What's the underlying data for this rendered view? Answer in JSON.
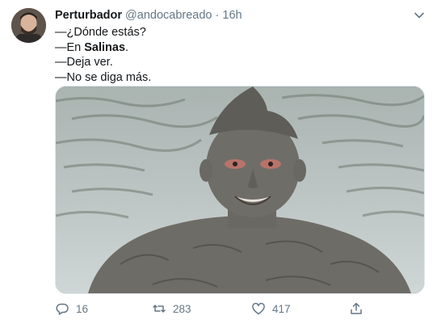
{
  "tweet": {
    "display_name": "Perturbador",
    "handle": "@andocabreado",
    "separator": "·",
    "time": "16h",
    "lines": [
      {
        "pre": "—¿Dónde estás?",
        "bold": "",
        "post": ""
      },
      {
        "pre": "—En ",
        "bold": "Salinas",
        "post": "."
      },
      {
        "pre": "—Deja ver.",
        "bold": "",
        "post": ""
      },
      {
        "pre": "—No se diga más.",
        "bold": "",
        "post": ""
      }
    ],
    "media": {
      "description_icon": "photo-person-covered-in-mud"
    },
    "actions": {
      "reply_count": "16",
      "retweet_count": "283",
      "like_count": "417"
    }
  },
  "colors": {
    "text": "#14171a",
    "secondary": "#657786",
    "border": "#e1e8ed"
  },
  "icons": [
    "avatar",
    "chevron-down-icon",
    "reply-icon",
    "retweet-icon",
    "like-icon",
    "share-icon"
  ]
}
